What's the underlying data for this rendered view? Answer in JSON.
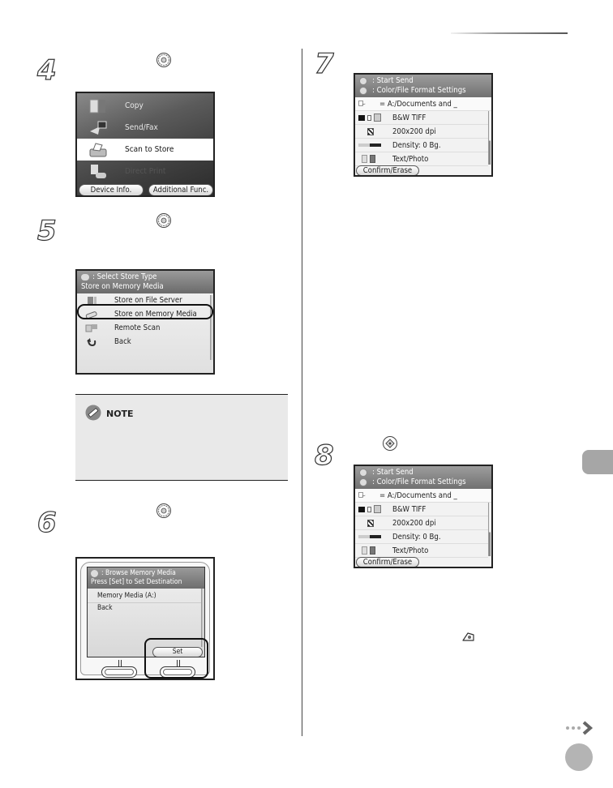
{
  "page": {
    "accent_gray": "#a6a6a6",
    "rule_color": "#555555"
  },
  "steps": [
    {
      "number": "4",
      "key_icon": "ok-key-icon"
    },
    {
      "number": "5",
      "key_icon": "ok-key-icon"
    },
    {
      "number": "6",
      "key_icon": "ok-key-icon"
    },
    {
      "number": "7"
    },
    {
      "number": "8",
      "key_icon": "start-key-icon"
    }
  ],
  "main_menu": {
    "items": [
      {
        "label": "Copy",
        "icon": "copy-icon",
        "state": "normal"
      },
      {
        "label": "Send/Fax",
        "icon": "send-fax-icon",
        "state": "normal"
      },
      {
        "label": "Scan to Store",
        "icon": "scanner-icon",
        "state": "selected"
      },
      {
        "label": "Direct Print",
        "icon": "direct-print-icon",
        "state": "dimmed"
      }
    ],
    "buttons": {
      "device_info": "Device Info.",
      "additional_func": "Additional Func."
    }
  },
  "store_type": {
    "header_line1": ": Select Store Type",
    "header_line2": "Store on Memory Media",
    "items": [
      {
        "label": "Store on File Server",
        "icon": "file-server-icon"
      },
      {
        "label": "Store on Memory Media",
        "icon": "memory-media-icon",
        "highlighted": true
      },
      {
        "label": "Remote Scan",
        "icon": "remote-scan-icon"
      },
      {
        "label": "Back",
        "icon": "back-arrow-icon"
      }
    ]
  },
  "note": {
    "label": "NOTE"
  },
  "browse": {
    "header_line1": ": Browse Memory Media",
    "header_line2": "Press [Set] to Set Destination",
    "items": [
      "Memory Media (A:)",
      "Back"
    ],
    "set_button": "Set"
  },
  "send_settings": {
    "header_line1": ": Start Send",
    "header_line2": ": Color/File Format Settings",
    "destination": "= A:/Documents and _",
    "rows": [
      "B&W TIFF",
      "200x200 dpi",
      "Density: 0 Bg.",
      "Text/Photo"
    ],
    "confirm_button": "Confirm/Erase"
  }
}
